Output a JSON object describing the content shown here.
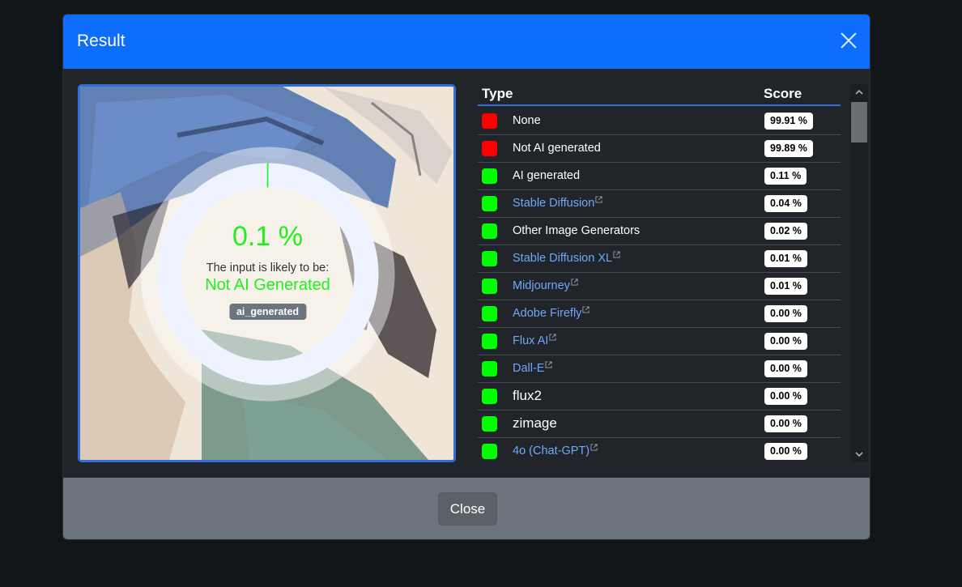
{
  "modal": {
    "title": "Result",
    "close_icon": "close-icon",
    "footer_close_label": "Close"
  },
  "result": {
    "percentage": "0.1 %",
    "ai_fraction": 0.001,
    "likely_text": "The input is likely to be:",
    "verdict": "Not AI Generated",
    "badge": "ai_generated",
    "colors": {
      "gauge_ring": "#eef3ff",
      "gauge_mark": "#22f01c",
      "verdict": "#22f01c"
    }
  },
  "table": {
    "headers": {
      "type": "Type",
      "score": "Score"
    },
    "rows": [
      {
        "label": "None",
        "score": "99.91 %",
        "status": "red",
        "link": false,
        "big": false
      },
      {
        "label": "Not AI generated",
        "score": "99.89 %",
        "status": "red",
        "link": false,
        "big": false
      },
      {
        "label": "AI generated",
        "score": "0.11 %",
        "status": "green",
        "link": false,
        "big": false
      },
      {
        "label": "Stable Diffusion",
        "score": "0.04 %",
        "status": "green",
        "link": true,
        "big": false
      },
      {
        "label": "Other Image Generators",
        "score": "0.02 %",
        "status": "green",
        "link": false,
        "big": false
      },
      {
        "label": "Stable Diffusion XL",
        "score": "0.01 %",
        "status": "green",
        "link": true,
        "big": false
      },
      {
        "label": "Midjourney",
        "score": "0.01 %",
        "status": "green",
        "link": true,
        "big": false
      },
      {
        "label": "Adobe Firefly",
        "score": "0.00 %",
        "status": "green",
        "link": true,
        "big": false
      },
      {
        "label": "Flux AI",
        "score": "0.00 %",
        "status": "green",
        "link": true,
        "big": false
      },
      {
        "label": "Dall-E",
        "score": "0.00 %",
        "status": "green",
        "link": true,
        "big": false
      },
      {
        "label": "flux2",
        "score": "0.00 %",
        "status": "green",
        "link": false,
        "big": true
      },
      {
        "label": "zimage",
        "score": "0.00 %",
        "status": "green",
        "link": false,
        "big": true
      },
      {
        "label": "4o (Chat-GPT)",
        "score": "0.00 %",
        "status": "green",
        "link": true,
        "big": false
      }
    ],
    "status_colors": {
      "red": "#ff0000",
      "green": "#00ff00"
    }
  },
  "scrollbar": {
    "up_icon": "chevron-up-icon",
    "down_icon": "chevron-down-icon"
  }
}
